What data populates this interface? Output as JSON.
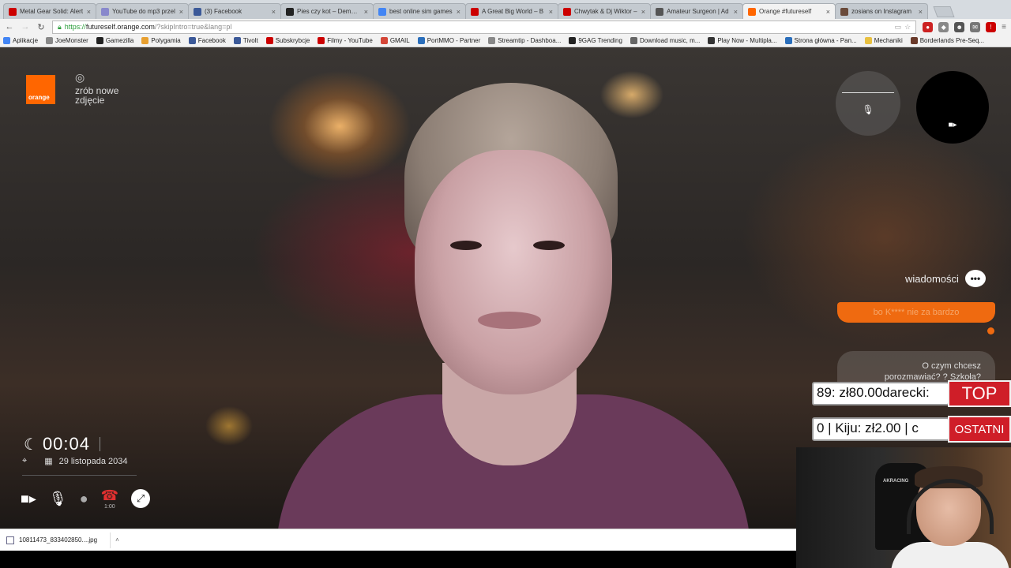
{
  "tabs": [
    {
      "title": "Metal Gear Solid: Alert",
      "color": "#cc0000"
    },
    {
      "title": "YouTube do mp3 przel",
      "color": "#8888cc"
    },
    {
      "title": "(3) Facebook",
      "color": "#3b5998"
    },
    {
      "title": "Pies czy kot – Demotyw",
      "color": "#222222"
    },
    {
      "title": "best online sim games",
      "color": "#4285f4"
    },
    {
      "title": "A Great Big World – B",
      "color": "#cc0000"
    },
    {
      "title": "Chwytak & Dj Wiktor –",
      "color": "#cc0000"
    },
    {
      "title": "Amateur Surgeon | Ad",
      "color": "#555555"
    },
    {
      "title": "Orange #futureself",
      "color": "#ff6600"
    },
    {
      "title": "zosians on Instagram",
      "color": "#6a4a3a"
    }
  ],
  "address": {
    "https": "https://",
    "host": "futureself.orange.com",
    "path": "/?skipIntro=true&lang=pl"
  },
  "bookmarks": [
    {
      "label": "Aplikacje",
      "color": "#4285f4"
    },
    {
      "label": "JoeMonster",
      "color": "#888888"
    },
    {
      "label": "Gamezilla",
      "color": "#222222"
    },
    {
      "label": "Polygamia",
      "color": "#e8a030"
    },
    {
      "label": "Facebook",
      "color": "#3b5998"
    },
    {
      "label": "Tivolt",
      "color": "#3b5998"
    },
    {
      "label": "Subskrybcje",
      "color": "#cc0000"
    },
    {
      "label": "Filmy - YouTube",
      "color": "#cc0000"
    },
    {
      "label": "GMAIL",
      "color": "#d44638"
    },
    {
      "label": "PortMMO - Partner",
      "color": "#2a6ebb"
    },
    {
      "label": "Streamtip - Dashboa...",
      "color": "#888888"
    },
    {
      "label": "9GAG Trending",
      "color": "#222222"
    },
    {
      "label": "Download music, m...",
      "color": "#666666"
    },
    {
      "label": "Play Now - Multipla...",
      "color": "#333333"
    },
    {
      "label": "Strona główna - Pan...",
      "color": "#2a6ebb"
    },
    {
      "label": "Mechaniki",
      "color": "#e8c040"
    },
    {
      "label": "Borderlands Pre-Seq...",
      "color": "#6a3a2a"
    }
  ],
  "app": {
    "logo_text": "orange",
    "photo_cta_line1": "zrób nowe",
    "photo_cta_line2": "zdjęcie",
    "time": "00:04",
    "date": "29 listopada 2034",
    "call_duration": "1:00",
    "messages_label": "wiadomości",
    "chat_outgoing": "bo K**** nie za bardzo",
    "chat_incoming_line1": "O czym chcesz",
    "chat_incoming_line2": "porozmawiać? ? Szkoła?"
  },
  "stream_overlay": {
    "top_donation": "89: zł80.00darecki: ",
    "last_donation": "0 |  Kiju: zł2.00 |  c",
    "top_label": "TOP",
    "last_label": "OSTATNI",
    "chair_brand": "AKRACING"
  },
  "downloads": {
    "file": "10811473_833402850....jpg"
  },
  "colors": {
    "orange_brand": "#ff6600",
    "badge_red": "#cf1e28",
    "chat_orange": "#ef6a10"
  }
}
